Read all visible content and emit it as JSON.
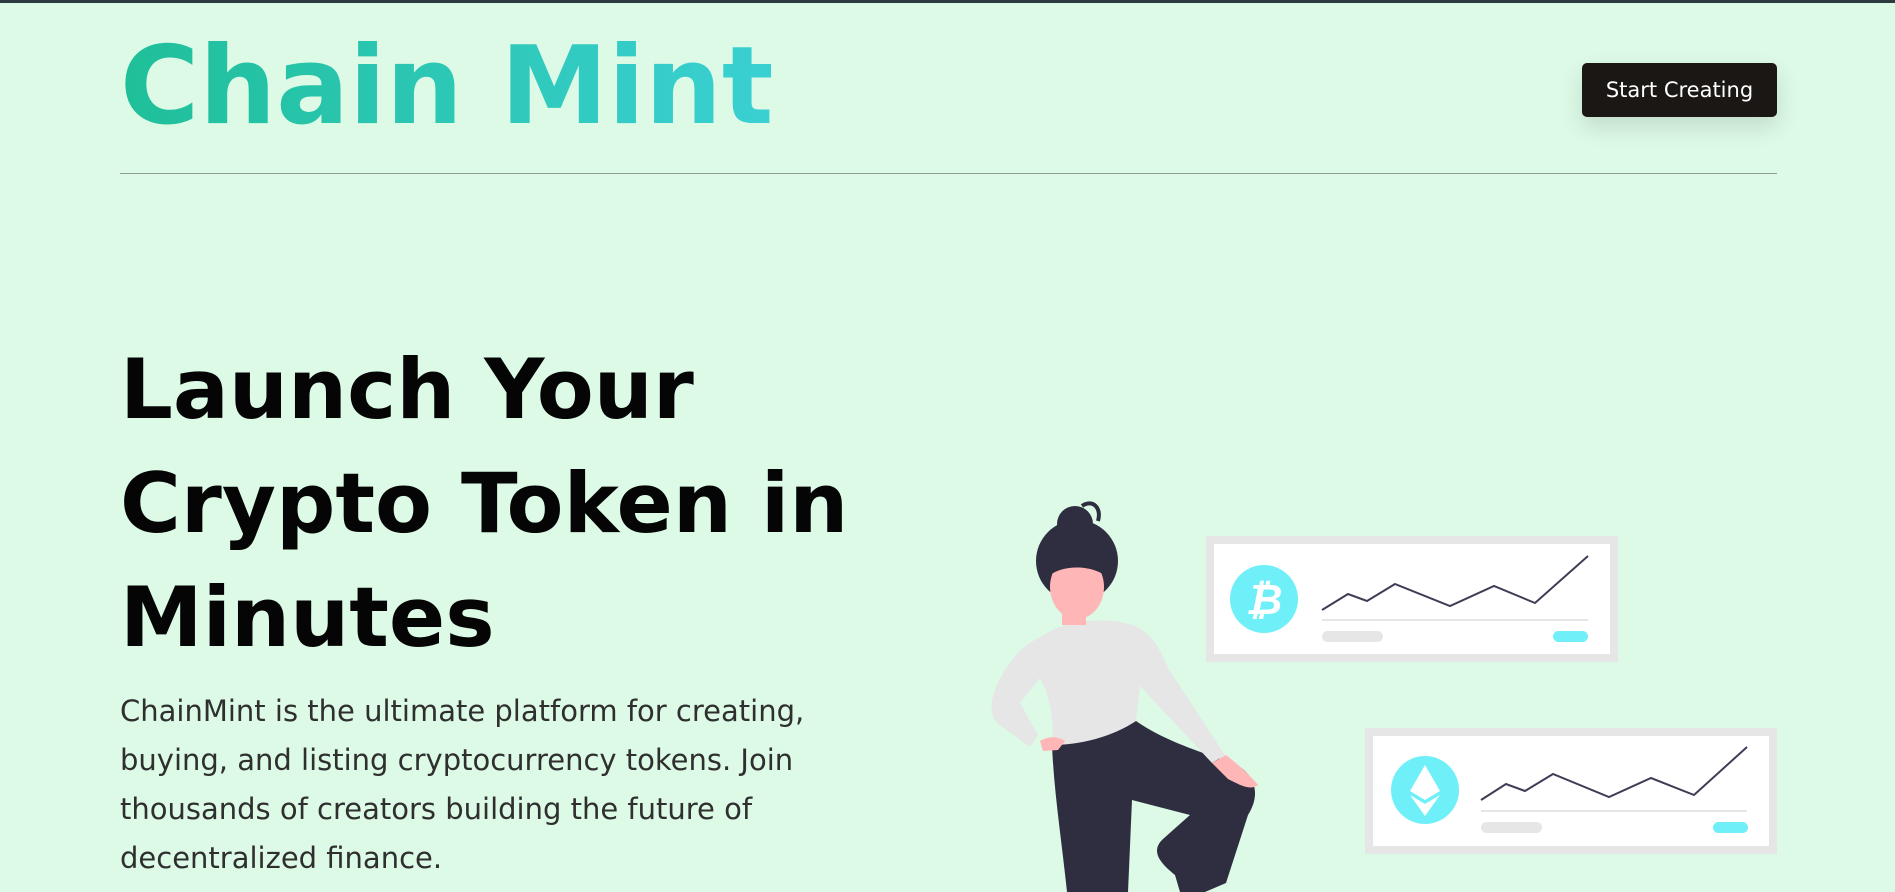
{
  "header": {
    "logo_text": "Chain Mint",
    "cta_label": "Start Creating"
  },
  "hero": {
    "title": "Launch Your Crypto Token in Minutes",
    "description": "ChainMint is the ultimate platform for creating, buying, and listing cryptocurrency tokens. Join thousands of creators building the future of decentralized finance."
  },
  "illustration": {
    "cards": [
      {
        "coin_icon": "bitcoin-icon"
      },
      {
        "coin_icon": "ethereum-icon"
      }
    ]
  },
  "colors": {
    "page_bg": "#dcfae6",
    "logo_gradient_start": "#1fbf99",
    "logo_gradient_end": "#3ad0d3",
    "button_bg": "#1b1715",
    "coin_accent": "#6ff0f8",
    "figure_dark": "#2f2e41"
  }
}
